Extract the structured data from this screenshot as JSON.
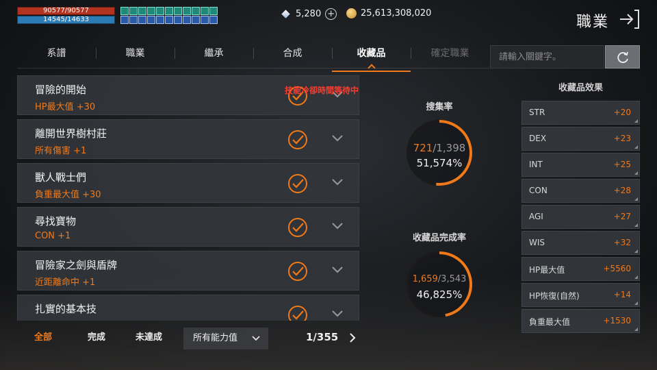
{
  "status": {
    "hp": "90577/90577",
    "mp": "14545/14633"
  },
  "currency": {
    "diamonds": "5,280",
    "gold": "25,613,308,020"
  },
  "header": {
    "title": "職業"
  },
  "tabs": [
    {
      "label": "系譜",
      "state": "normal"
    },
    {
      "label": "職業",
      "state": "normal"
    },
    {
      "label": "繼承",
      "state": "normal"
    },
    {
      "label": "合成",
      "state": "normal"
    },
    {
      "label": "收藏品",
      "state": "active"
    },
    {
      "label": "確定職業",
      "state": "disabled"
    }
  ],
  "search": {
    "placeholder": "請輸入關鍵字。"
  },
  "collection": {
    "cooldown_message": "技能冷卻時間等待中",
    "items": [
      {
        "name": "冒險的開始",
        "bonus": "HP最大值  +30"
      },
      {
        "name": "離開世界樹村莊",
        "bonus": "所有傷害  +1"
      },
      {
        "name": "獸人戰士們",
        "bonus": "負重最大值  +30"
      },
      {
        "name": "尋找寶物",
        "bonus": "CON  +1"
      },
      {
        "name": "冒險家之劍與盾牌",
        "bonus": "近距離命中  +1"
      },
      {
        "name": "扎實的基本技",
        "bonus": ""
      }
    ]
  },
  "filters": {
    "all": "全部",
    "done": "完成",
    "undone": "未達成",
    "dropdown": "所有能力值",
    "page": "1/355"
  },
  "stats": {
    "collect_rate": {
      "title": "搜集率",
      "current": "721",
      "total": "/1,398",
      "percent": "51,574%",
      "fraction": 0.5157
    },
    "complete_rate": {
      "title": "收藏品完成率",
      "current": "1,659",
      "total": "/3,543",
      "percent": "46,825%",
      "fraction": 0.4683
    }
  },
  "effects": {
    "title": "收藏品效果",
    "rows": [
      {
        "label": "STR",
        "value": "+20"
      },
      {
        "label": "DEX",
        "value": "+23"
      },
      {
        "label": "INT",
        "value": "+25"
      },
      {
        "label": "CON",
        "value": "+28"
      },
      {
        "label": "AGI",
        "value": "+27"
      },
      {
        "label": "WIS",
        "value": "+32"
      },
      {
        "label": "HP最大值",
        "value": "+5560"
      },
      {
        "label": "HP恢復(自然)",
        "value": "+14"
      },
      {
        "label": "負重最大值",
        "value": "+1530"
      }
    ]
  },
  "colors": {
    "accent": "#f07a1a",
    "warning": "#ff3b2e",
    "hp": "#b2331f",
    "mp": "#2d7bb4"
  }
}
